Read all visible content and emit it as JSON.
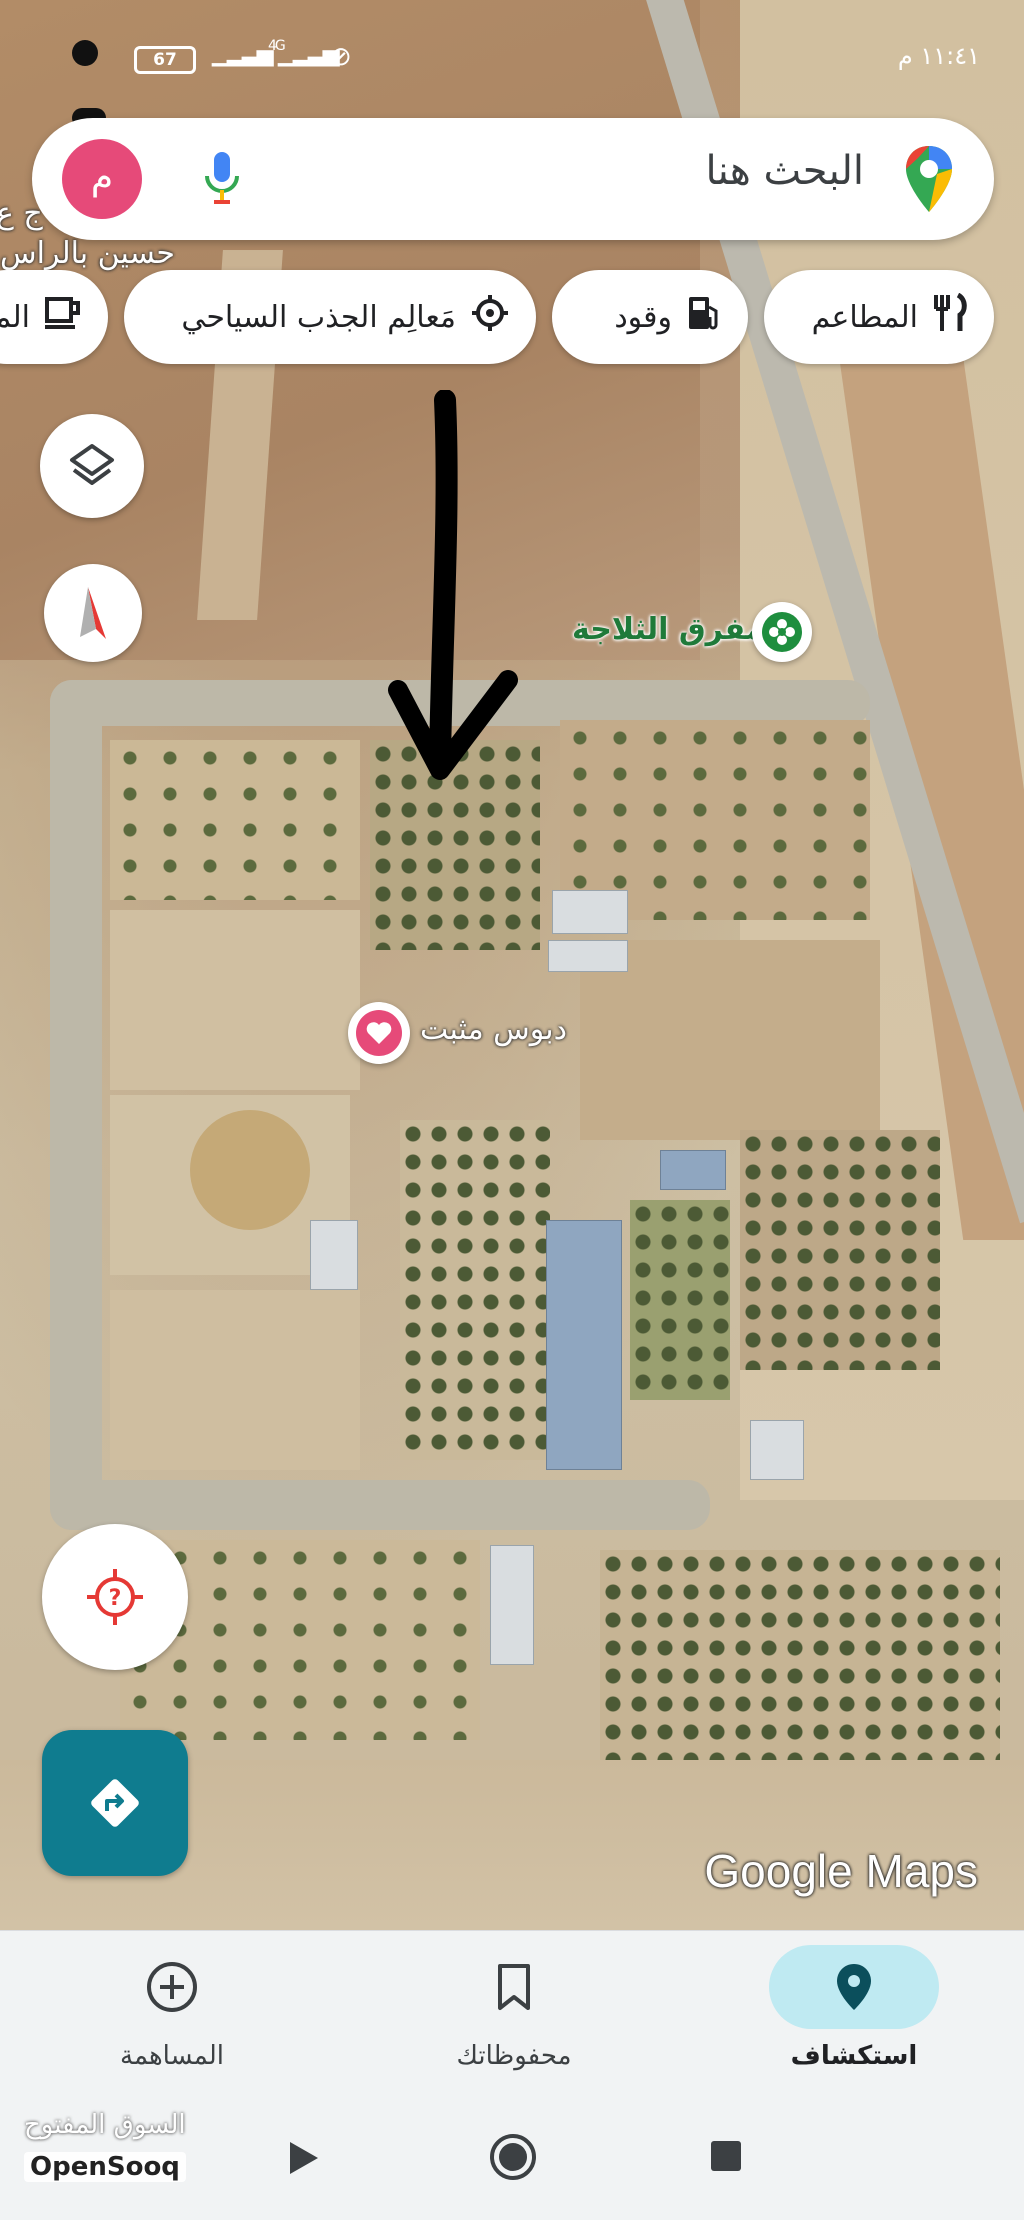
{
  "status_bar": {
    "time": "١١:٤١ م",
    "battery": "67",
    "network": "4G"
  },
  "search": {
    "placeholder": "البحث هنا",
    "avatar_letter": "م"
  },
  "chips": [
    {
      "label": "المطاعم",
      "icon": "fork-knife-icon"
    },
    {
      "label": "وقود",
      "icon": "gas-pump-icon"
    },
    {
      "label": "مَعالِم الجذب السياحي",
      "icon": "attraction-icon"
    },
    {
      "label": "المـ",
      "icon": "coffee-cup-icon"
    }
  ],
  "map": {
    "top_label": "حسين بالراس",
    "top_label_partial": "ج ع",
    "poi_label": "مفرق الثلاجة",
    "pin_label": "دبوس مثبت",
    "attribution": "Google Maps"
  },
  "bottom_nav": [
    {
      "label": "استكشاف",
      "icon": "location-pin-icon",
      "active": true
    },
    {
      "label": "محفوظاتك",
      "icon": "bookmark-icon",
      "active": false
    },
    {
      "label": "المساهمة",
      "icon": "add-circle-icon",
      "active": false
    }
  ],
  "watermark": {
    "arabic": "السوق المفتوح",
    "english": "OpenSooq"
  },
  "colors": {
    "accent": "#0f7c8f",
    "avatar": "#e64a79",
    "pin": "#e64a79",
    "nav_active": "#bfeaf2"
  }
}
